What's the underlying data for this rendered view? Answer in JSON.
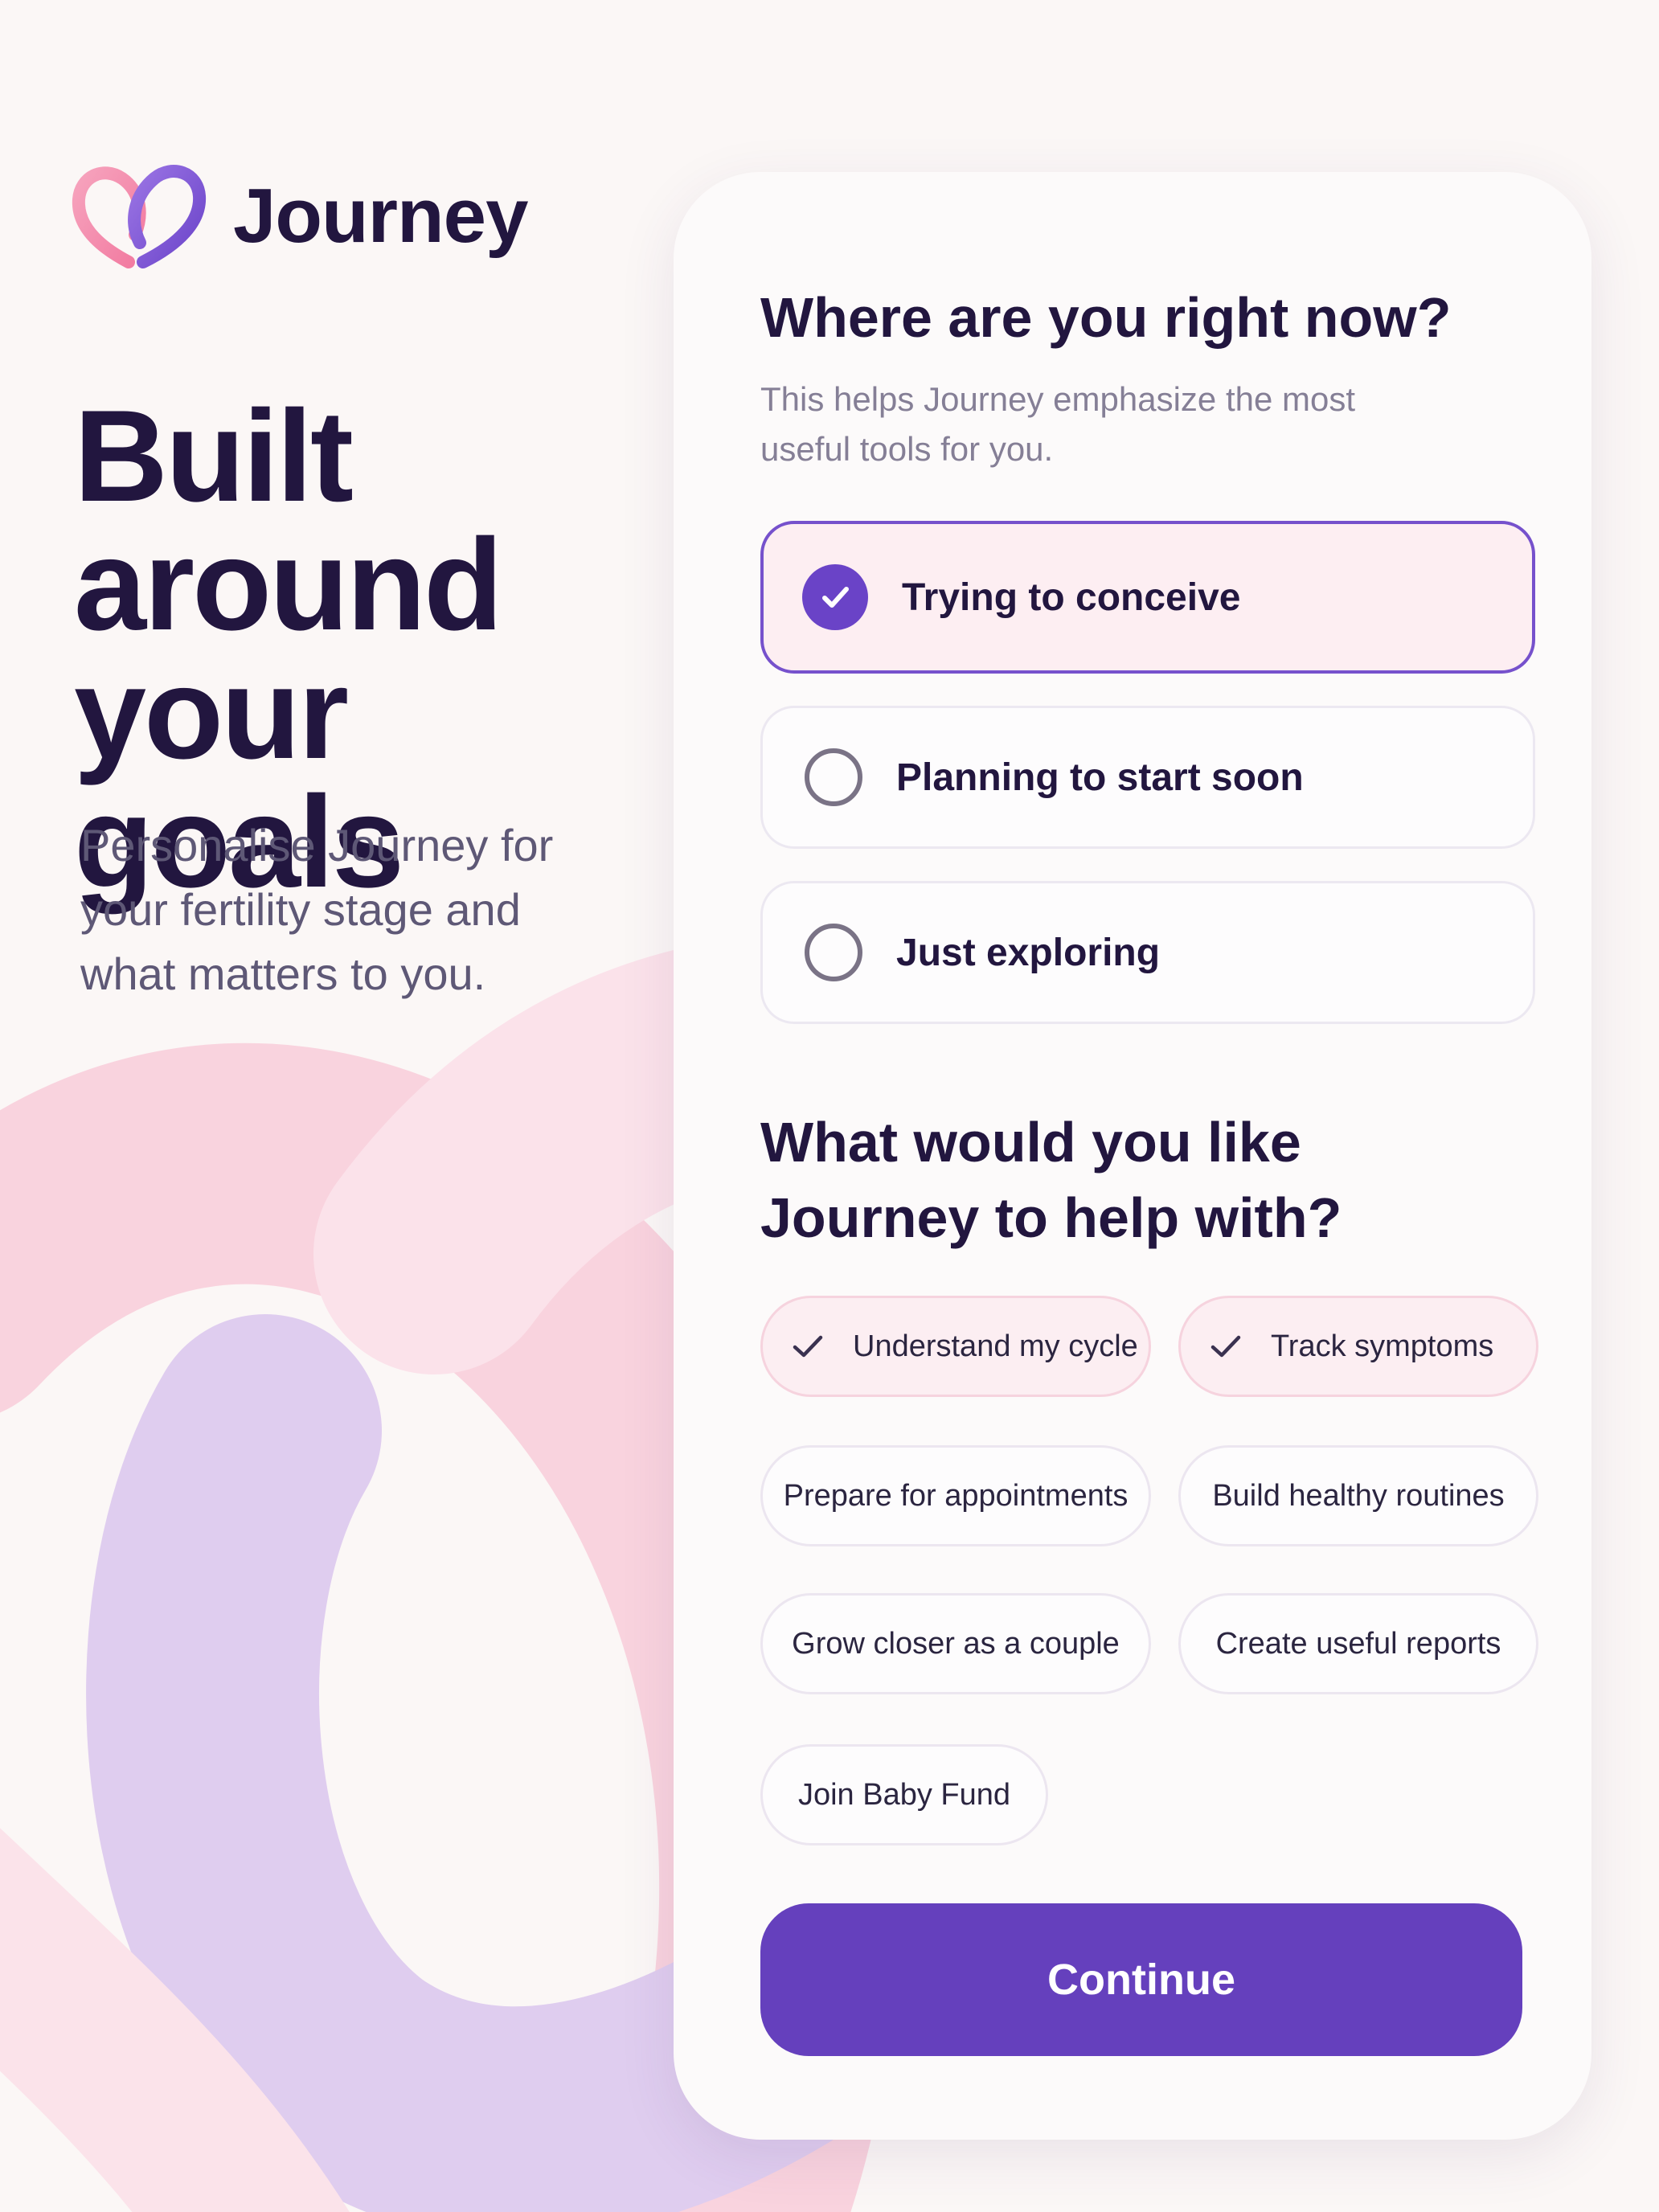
{
  "brand": {
    "name": "Journey"
  },
  "hero": {
    "headline": [
      "Built",
      "around",
      "your goals"
    ],
    "subtitle": "Personalise Journey for your fertility stage and what matters to you."
  },
  "stage_question": {
    "title": "Where are you right now?",
    "subtitle": "This helps Journey emphasize the most useful tools for you.",
    "options": [
      {
        "label": "Trying to conceive",
        "selected": true
      },
      {
        "label": "Planning to start soon",
        "selected": false
      },
      {
        "label": "Just exploring",
        "selected": false
      }
    ]
  },
  "help_question": {
    "title": "What would you like Journey to help with?",
    "chips": [
      {
        "label": "Understand my cycle",
        "selected": true
      },
      {
        "label": "Track symptoms",
        "selected": true
      },
      {
        "label": "Prepare for appointments",
        "selected": false
      },
      {
        "label": "Build healthy routines",
        "selected": false
      },
      {
        "label": "Grow closer as a couple",
        "selected": false
      },
      {
        "label": "Create useful reports",
        "selected": false
      },
      {
        "label": "Join Baby Fund",
        "selected": false
      }
    ]
  },
  "actions": {
    "continue_label": "Continue"
  },
  "colors": {
    "primary": "#6540bd",
    "text_dark": "#22163f",
    "selected_bg": "#fdeef2",
    "background": "#fbf7f6",
    "ribbon_pink": "#f9d6df",
    "ribbon_lilac": "#dccbee"
  }
}
